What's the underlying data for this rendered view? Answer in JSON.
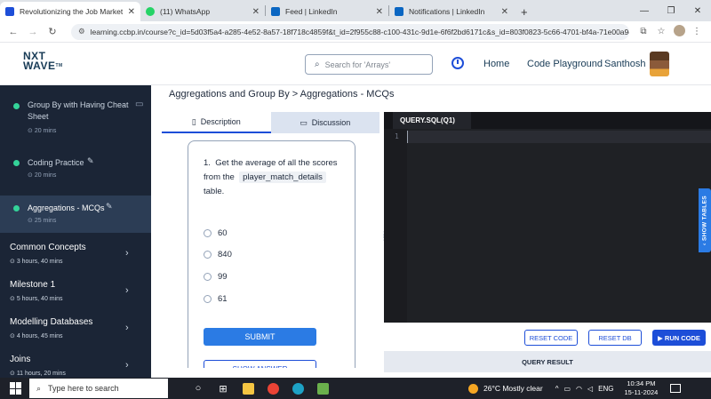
{
  "browser": {
    "tabs": [
      {
        "title": "Revolutionizing the Job Market",
        "color": "#1d4ed8",
        "active": true
      },
      {
        "title": "(11) WhatsApp",
        "color": "#25d366",
        "active": false
      },
      {
        "title": "Feed | LinkedIn",
        "color": "#0a66c2",
        "active": false
      },
      {
        "title": "Notifications | LinkedIn",
        "color": "#0a66c2",
        "active": false
      }
    ],
    "url": "learning.ccbp.in/course?c_id=5d03f5a4-a285-4e52-8a57-18f718c4859f&t_id=2f955c88-c100-431c-9d1e-6f6f2bd6171c&s_id=803f0823-5c66-4701-bf4a-71e00a9cbd60"
  },
  "header": {
    "logo_line1": "NXT",
    "logo_line2": "WAVE",
    "logo_tm": "TM",
    "search_placeholder": "Search for 'Arrays'",
    "home": "Home",
    "code_playground": "Code Playground",
    "user_name": "Santhosh"
  },
  "sidebar": {
    "subtopics": [
      {
        "title_line1": "Group By with Having Cheat",
        "title_line2": "Sheet",
        "meta": "20 mins"
      },
      {
        "title": "Coding Practice",
        "meta": "20 mins"
      },
      {
        "title": "Aggregations - MCQs",
        "meta": "25 mins"
      }
    ],
    "modules": [
      {
        "title": "Common Concepts",
        "meta": "3 hours, 40 mins"
      },
      {
        "title": "Milestone 1",
        "meta": "5 hours, 40 mins"
      },
      {
        "title": "Modelling Databases",
        "meta": "4 hours, 45 mins"
      },
      {
        "title": "Joins",
        "meta": "11 hours, 20 mins"
      }
    ]
  },
  "content": {
    "breadcrumb": "Aggregations and Group By > Aggregations - MCQs",
    "tab_description": "Description",
    "tab_discussion": "Discussion",
    "question": {
      "number": "1.",
      "text_part1": "Get the average of all the scores from the",
      "code": "player_match_details",
      "text_part2": "table."
    },
    "options": [
      "60",
      "840",
      "99",
      "61"
    ],
    "submit": "SUBMIT",
    "show_answer": "SHOW ANSWER"
  },
  "editor": {
    "tab": "QUERY.SQL(Q1)",
    "line1": "1",
    "show_tables": "SHOW TABLES",
    "reset_code": "RESET CODE",
    "reset_db": "RESET DB",
    "run_code": "RUN CODE",
    "query_result": "QUERY RESULT"
  },
  "taskbar": {
    "search_placeholder": "Type here to search",
    "weather": "26°C  Mostly clear",
    "lang": "ENG",
    "time": "10:34 PM",
    "date": "15-11-2024"
  }
}
